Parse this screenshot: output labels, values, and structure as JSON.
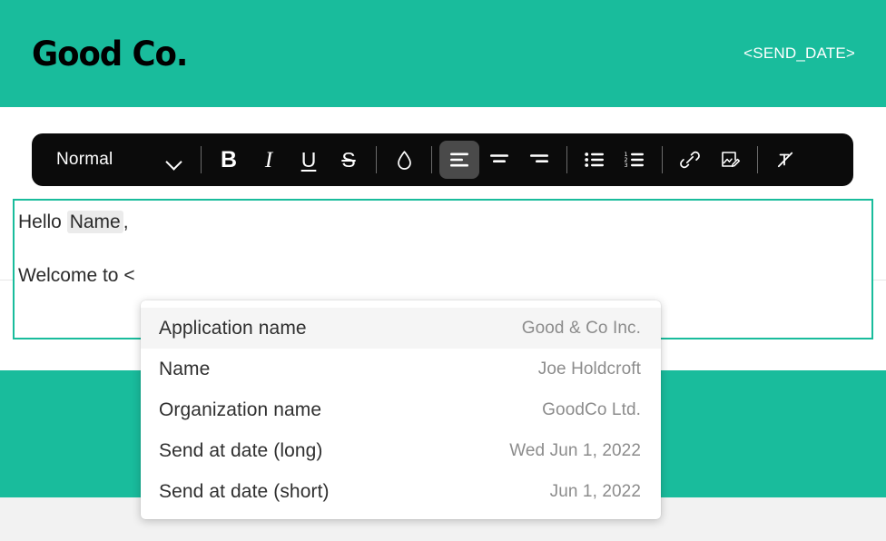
{
  "header": {
    "logo": "Good Co.",
    "send_date_token": "<SEND_DATE>",
    "background_color": "#19bc9c",
    "logo_color": "#000000",
    "token_color": "#ffffff"
  },
  "toolbar": {
    "style_select": {
      "value": "Normal",
      "chevron_icon": "chevron-down-icon"
    },
    "buttons": [
      {
        "name": "bold",
        "glyph": "B",
        "icon": "bold-icon",
        "active": false
      },
      {
        "name": "italic",
        "glyph": "I",
        "icon": "italic-icon",
        "active": false
      },
      {
        "name": "underline",
        "glyph": "U",
        "icon": "underline-icon",
        "active": false
      },
      {
        "name": "strikethrough",
        "glyph": "S",
        "icon": "strikethrough-icon",
        "active": false
      },
      {
        "name": "text-color",
        "glyph": "",
        "icon": "droplet-color-icon",
        "active": false
      },
      {
        "name": "align-left",
        "glyph": "",
        "icon": "align-left-icon",
        "active": true
      },
      {
        "name": "align-center",
        "glyph": "",
        "icon": "align-center-icon",
        "active": false
      },
      {
        "name": "align-right",
        "glyph": "",
        "icon": "align-right-icon",
        "active": false
      },
      {
        "name": "bullet-list",
        "glyph": "",
        "icon": "bullet-list-icon",
        "active": false
      },
      {
        "name": "numbered-list",
        "glyph": "",
        "icon": "numbered-list-icon",
        "active": false
      },
      {
        "name": "link",
        "glyph": "",
        "icon": "link-icon",
        "active": false
      },
      {
        "name": "insert-image",
        "glyph": "",
        "icon": "image-edit-icon",
        "active": false
      },
      {
        "name": "clear-format",
        "glyph": "",
        "icon": "clear-formatting-icon",
        "active": false
      }
    ],
    "background_color": "#0b0b0b",
    "active_button_color": "#4a4a4a"
  },
  "editor": {
    "border_color": "#19bc9c",
    "line_1": {
      "prefix": "Hello ",
      "merge_tag": "Name",
      "suffix": ","
    },
    "line_2": "Welcome to <"
  },
  "tag_menu": {
    "rows": [
      {
        "label": "Application name",
        "value": "Good & Co Inc.",
        "highlighted": true
      },
      {
        "label": "Name",
        "value": "Joe Holdcroft",
        "highlighted": false
      },
      {
        "label": "Organization name",
        "value": "GoodCo Ltd.",
        "highlighted": false
      },
      {
        "label": "Send at date (long)",
        "value": "Wed Jun 1, 2022",
        "highlighted": false
      },
      {
        "label": "Send at date (short)",
        "value": "Jun 1, 2022",
        "highlighted": false
      }
    ],
    "highlight_color": "#f5f5f5",
    "label_color": "#2f2f2f",
    "value_color": "#8c8c8c"
  },
  "footer": {
    "band_color": "#19bc9c",
    "page_background": "#f2f2f2"
  }
}
